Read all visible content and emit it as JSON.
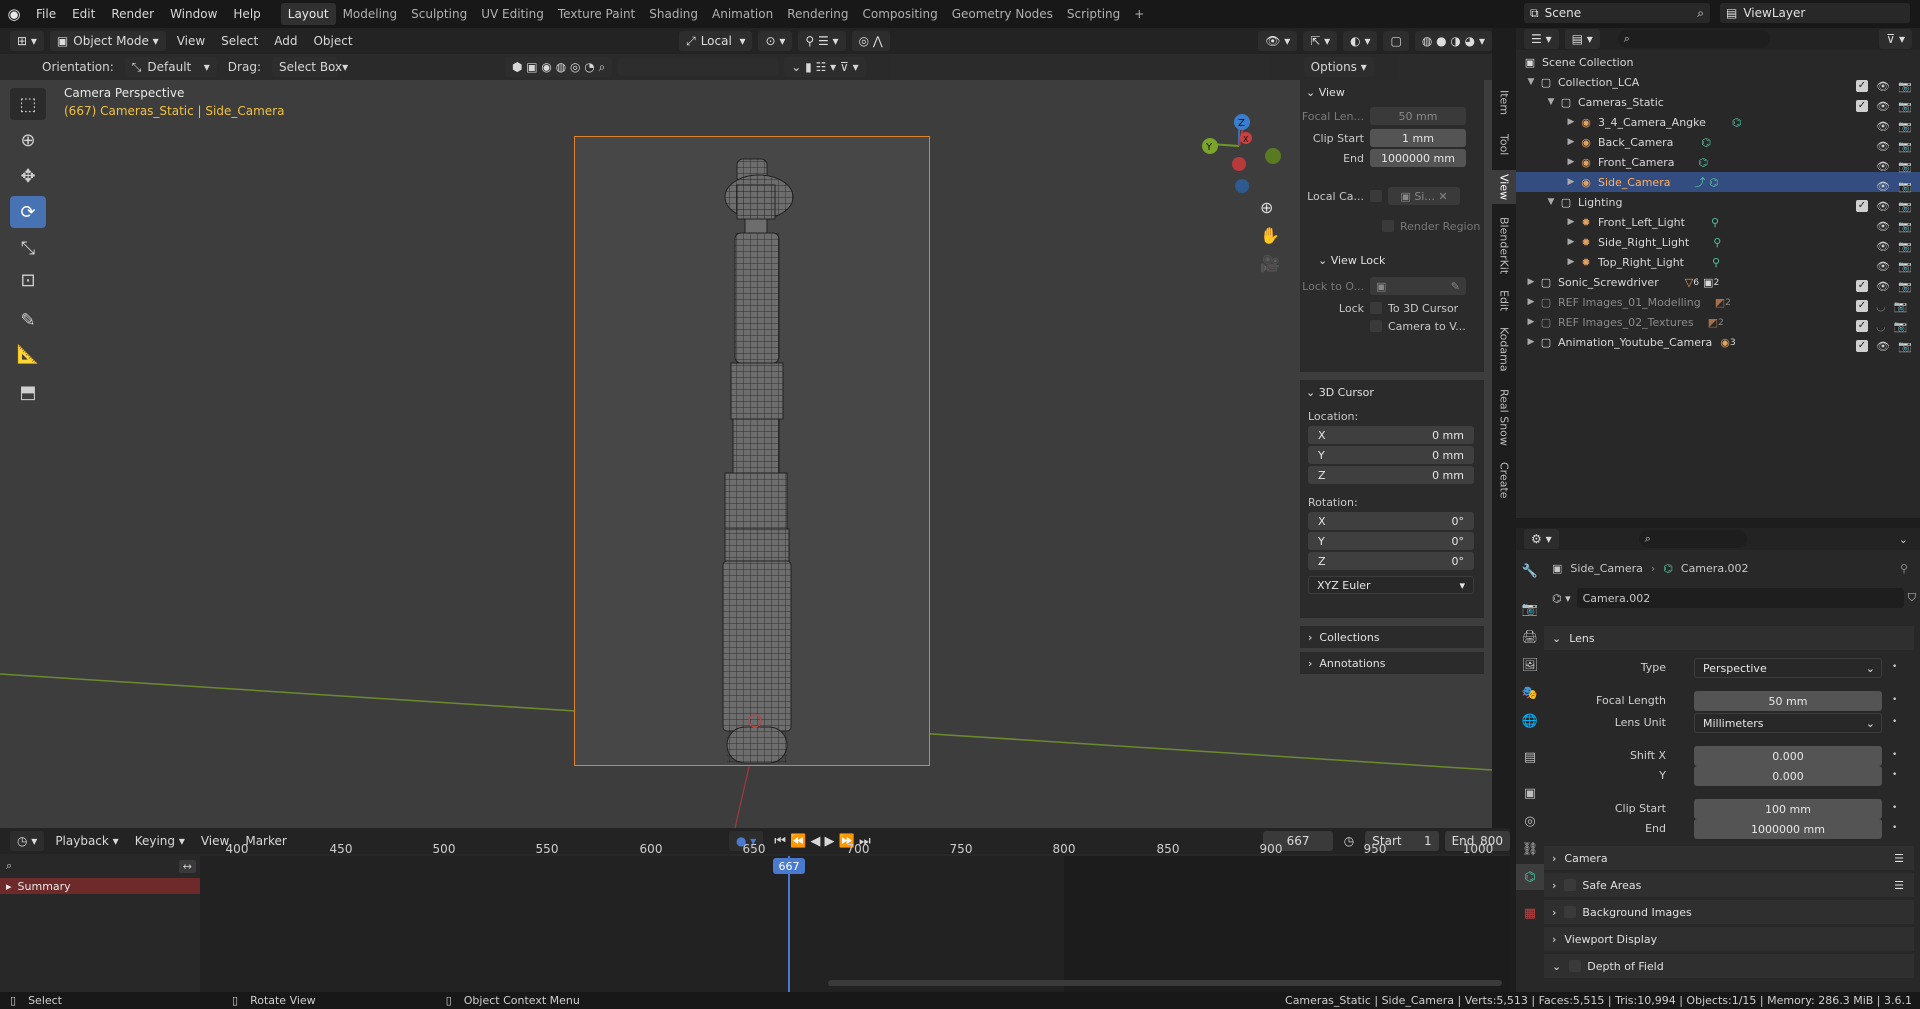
{
  "menu": {
    "items": [
      "File",
      "Edit",
      "Render",
      "Window",
      "Help"
    ]
  },
  "workspaces": {
    "tabs": [
      "Layout",
      "Modeling",
      "Sculpting",
      "UV Editing",
      "Texture Paint",
      "Shading",
      "Animation",
      "Rendering",
      "Compositing",
      "Geometry Nodes",
      "Scripting"
    ],
    "add": "+"
  },
  "scene": {
    "name": "Scene",
    "viewlayer": "ViewLayer"
  },
  "viewport": {
    "mode": "Object Mode",
    "menus": [
      "View",
      "Select",
      "Add",
      "Object"
    ],
    "transform_space": "Local",
    "orientation_label": "Orientation:",
    "orientation_value": "Default",
    "drag_label": "Drag:",
    "drag_value": "Select Box",
    "options_label": "Options",
    "overlay_title": "Camera Perspective",
    "overlay_sub": "(667) Cameras_Static | Side_Camera"
  },
  "npanel": {
    "view_header": "View",
    "focal_label": "Focal Len...",
    "focal_value": "50 mm",
    "clip_start_label": "Clip Start",
    "clip_start_value": "1 mm",
    "end_label": "End",
    "end_value": "1000000 mm",
    "local_camera_label": "Local Ca...",
    "local_camera_value": "Si...",
    "render_region": "Render Region",
    "view_lock_header": "View Lock",
    "lock_to_label": "Lock to O...",
    "lock_label": "Lock",
    "to_3d_cursor": "To 3D Cursor",
    "camera_to_view": "Camera to V...",
    "cursor_header": "3D Cursor",
    "location_label": "Location:",
    "loc": [
      {
        "axis": "X",
        "value": "0 mm"
      },
      {
        "axis": "Y",
        "value": "0 mm"
      },
      {
        "axis": "Z",
        "value": "0 mm"
      }
    ],
    "rotation_label": "Rotation:",
    "rot": [
      {
        "axis": "X",
        "value": "0°"
      },
      {
        "axis": "Y",
        "value": "0°"
      },
      {
        "axis": "Z",
        "value": "0°"
      }
    ],
    "rotation_mode": "XYZ Euler",
    "collections_header": "Collections",
    "annotations_header": "Annotations"
  },
  "sidetabs": [
    "Item",
    "Tool",
    "View",
    "BlenderKit",
    "Edit",
    "Kodama",
    "Real Snow",
    "Create"
  ],
  "outliner": {
    "rows": [
      {
        "label": "Scene Collection"
      },
      {
        "label": "Collection_LCA"
      },
      {
        "label": "Cameras_Static"
      },
      {
        "label": "3_4_Camera_Angke"
      },
      {
        "label": "Back_Camera"
      },
      {
        "label": "Front_Camera"
      },
      {
        "label": "Side_Camera"
      },
      {
        "label": "Lighting"
      },
      {
        "label": "Front_Left_Light"
      },
      {
        "label": "Side_Right_Light"
      },
      {
        "label": "Top_Right_Light"
      },
      {
        "label": "Sonic_Screwdriver"
      },
      {
        "label": "REF Images_01_Modelling"
      },
      {
        "label": "REF Images_02_Textures"
      },
      {
        "label": "Animation_Youtube_Camera"
      }
    ],
    "badges": {
      "sonic": "6",
      "sonic2": "2",
      "ref1": "2",
      "ref2": "2",
      "anim": "3"
    }
  },
  "properties": {
    "breadcrumb_object": "Side_Camera",
    "breadcrumb_data": "Camera.002",
    "datablock": "Camera.002",
    "lens_header": "Lens",
    "type_label": "Type",
    "type_value": "Perspective",
    "focal_label": "Focal Length",
    "focal_value": "50 mm",
    "lens_unit_label": "Lens Unit",
    "lens_unit_value": "Millimeters",
    "shift_x_label": "Shift X",
    "shift_x_value": "0.000",
    "shift_y_label": "Y",
    "shift_y_value": "0.000",
    "clip_start_label": "Clip Start",
    "clip_start_value": "100 mm",
    "clip_end_label": "End",
    "clip_end_value": "1000000 mm",
    "sections": [
      "Camera",
      "Safe Areas",
      "Background Images",
      "Viewport Display",
      "Depth of Field"
    ]
  },
  "timeline": {
    "menus": [
      "Playback",
      "Keying",
      "View",
      "Marker"
    ],
    "current_frame": "667",
    "start_label": "Start",
    "start_value": "1",
    "end_label": "End",
    "end_value": "800",
    "ticks": [
      "400",
      "450",
      "500",
      "550",
      "600",
      "650",
      "700",
      "750",
      "800",
      "850",
      "900",
      "950",
      "1000"
    ],
    "summary": "Summary"
  },
  "status": {
    "select": "Select",
    "rotate": "Rotate View",
    "context": "Object Context Menu",
    "stats": "Cameras_Static | Side_Camera | Verts:5,513 | Faces:5,515 | Tris:10,994 | Objects:1/15 | Memory: 286.3 MiB | 3.6.1"
  }
}
